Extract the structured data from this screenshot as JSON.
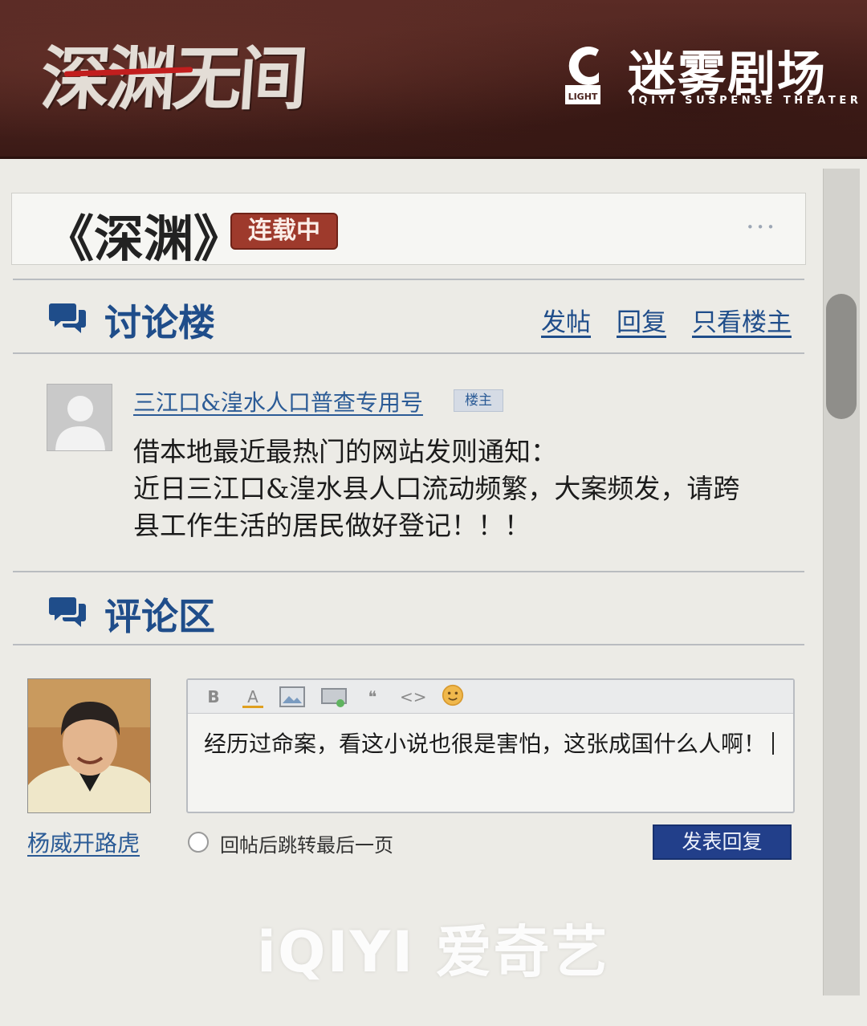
{
  "banner": {
    "show_logo": "深渊无间",
    "theater_name": "迷雾剧场",
    "theater_subtitle": "IQIYI SUSPENSE THEATER",
    "theater_mark_text": "LIGHT"
  },
  "title_bar": {
    "title": "《深渊》",
    "badge": "连载中",
    "more": "···"
  },
  "discussion": {
    "heading": "讨论楼",
    "links": [
      "发帖",
      "回复",
      "只看楼主"
    ]
  },
  "post": {
    "author": "三江口&湟水人口普查专用号",
    "author_tag": "楼主",
    "lines": [
      "借本地最近最热门的网站发则通知：",
      "近日三江口&湟水县人口流动频繁，大案频发，请跨",
      "县工作生活的居民做好登记！！！"
    ]
  },
  "comments": {
    "heading": "评论区",
    "commenter": "杨威开路虎",
    "toolbar": [
      "B",
      "A",
      "image-icon",
      "media-icon",
      "❝",
      "<>",
      "emoji-icon"
    ],
    "editor_text": "经历过命案，看这小说也很是害怕，这张成国什么人啊！",
    "checkbox_label": "回帖后跳转最后一页",
    "checkbox_checked": false,
    "submit": "发表回复"
  },
  "watermark": "iQIYI 爱奇艺"
}
